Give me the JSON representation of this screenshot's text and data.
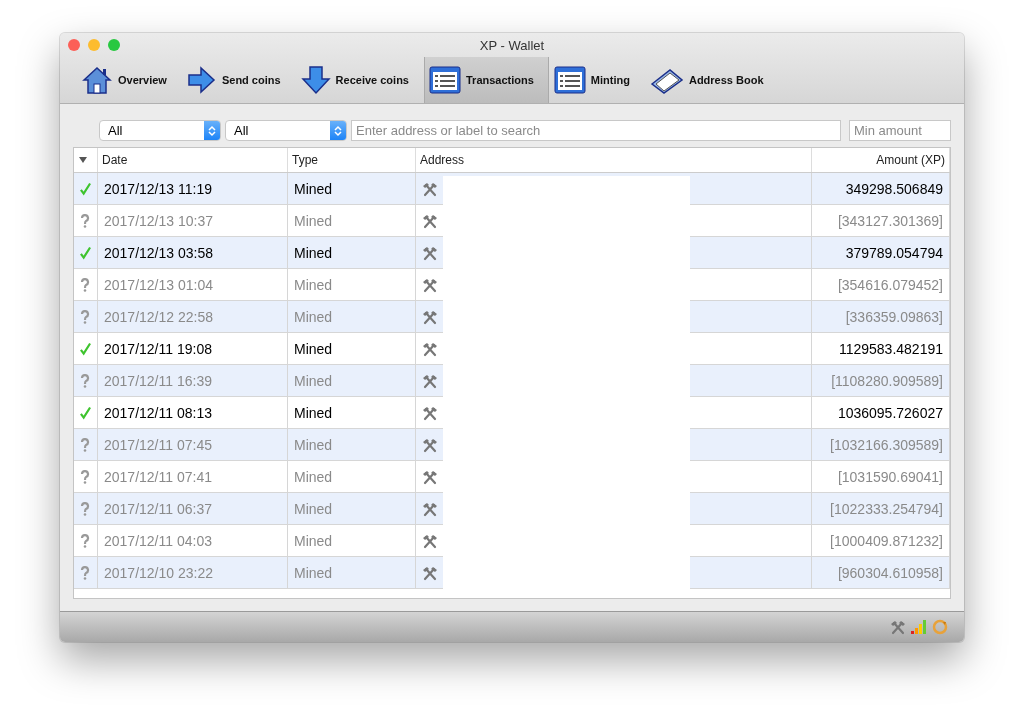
{
  "window": {
    "title": "XP - Wallet"
  },
  "toolbar": [
    {
      "label": "Overview",
      "kind": "house",
      "selected": false
    },
    {
      "label": "Send coins",
      "kind": "send",
      "selected": false
    },
    {
      "label": "Receive coins",
      "kind": "receive",
      "selected": false
    },
    {
      "label": "Transactions",
      "kind": "list",
      "selected": true
    },
    {
      "label": "Minting",
      "kind": "list",
      "selected": false
    },
    {
      "label": "Address Book",
      "kind": "book",
      "selected": false
    }
  ],
  "filters": {
    "date": "All",
    "type": "All",
    "search": {
      "placeholder": "Enter address or label to search"
    },
    "min_amount": {
      "placeholder": "Min amount"
    }
  },
  "table": {
    "columns": [
      "Date",
      "Type",
      "Address",
      "Amount (XP)"
    ],
    "rows": [
      {
        "confirmed": true,
        "date": "2017/12/13 11:19",
        "type": "Mined",
        "amount": "349298.506849"
      },
      {
        "confirmed": false,
        "date": "2017/12/13 10:37",
        "type": "Mined",
        "amount": "[343127.301369]"
      },
      {
        "confirmed": true,
        "date": "2017/12/13 03:58",
        "type": "Mined",
        "amount": "379789.054794"
      },
      {
        "confirmed": false,
        "date": "2017/12/13 01:04",
        "type": "Mined",
        "amount": "[354616.079452]"
      },
      {
        "confirmed": false,
        "date": "2017/12/12 22:58",
        "type": "Mined",
        "amount": "[336359.09863]"
      },
      {
        "confirmed": true,
        "date": "2017/12/11 19:08",
        "type": "Mined",
        "amount": "1129583.482191"
      },
      {
        "confirmed": false,
        "date": "2017/12/11 16:39",
        "type": "Mined",
        "amount": "[1108280.909589]"
      },
      {
        "confirmed": true,
        "date": "2017/12/11 08:13",
        "type": "Mined",
        "amount": "1036095.726027"
      },
      {
        "confirmed": false,
        "date": "2017/12/11 07:45",
        "type": "Mined",
        "amount": "[1032166.309589]"
      },
      {
        "confirmed": false,
        "date": "2017/12/11 07:41",
        "type": "Mined",
        "amount": "[1031590.69041]"
      },
      {
        "confirmed": false,
        "date": "2017/12/11 06:37",
        "type": "Mined",
        "amount": "[1022333.254794]"
      },
      {
        "confirmed": false,
        "date": "2017/12/11 04:03",
        "type": "Mined",
        "amount": "[1000409.871232]"
      },
      {
        "confirmed": false,
        "date": "2017/12/10 23:22",
        "type": "Mined",
        "amount": "[960304.610958]"
      }
    ]
  }
}
